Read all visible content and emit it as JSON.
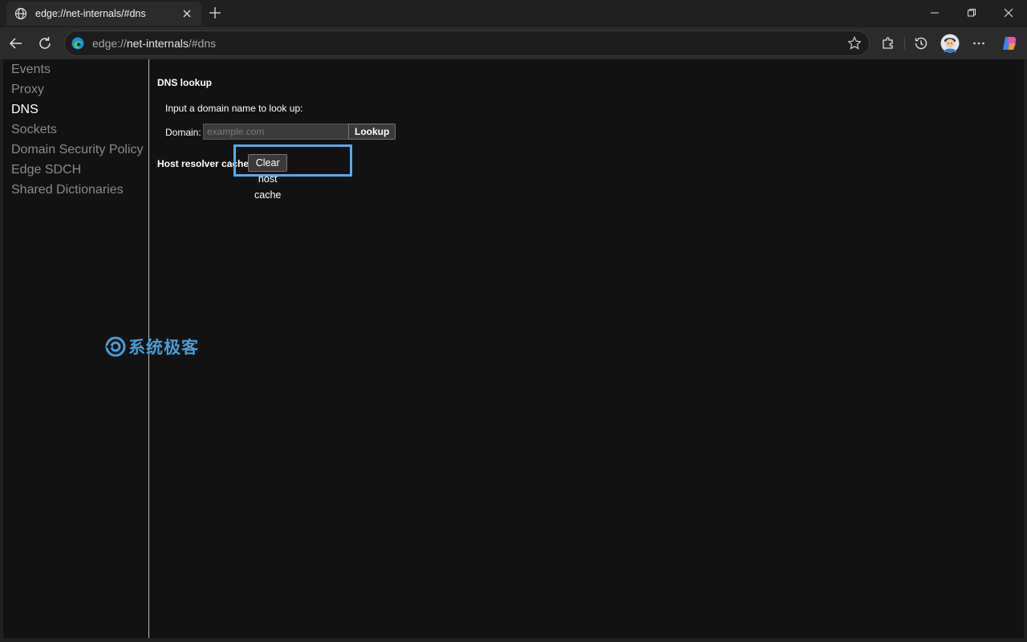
{
  "browser": {
    "tab": {
      "title": "edge://net-internals/#dns",
      "icon": "globe-icon"
    },
    "address_bar": {
      "scheme": "edge://",
      "host": "net-internals",
      "path": "/#dns",
      "icon": "edge-logo-icon"
    }
  },
  "sidebar": {
    "items": [
      {
        "label": "Events",
        "active": false
      },
      {
        "label": "Proxy",
        "active": false
      },
      {
        "label": "DNS",
        "active": true
      },
      {
        "label": "Sockets",
        "active": false
      },
      {
        "label": "Domain Security Policy",
        "active": false
      },
      {
        "label": "Edge SDCH",
        "active": false
      },
      {
        "label": "Shared Dictionaries",
        "active": false
      }
    ]
  },
  "dns_lookup": {
    "title": "DNS lookup",
    "prompt": "Input a domain name to look up:",
    "domain_label": "Domain:",
    "domain_placeholder": "example.com",
    "domain_value": "",
    "lookup_button": "Lookup"
  },
  "host_resolver": {
    "label": "Host resolver cache",
    "clear_button": "Clear host cache"
  },
  "watermark": {
    "text": "系统极客"
  },
  "colors": {
    "page_bg": "#121212",
    "chrome_bg": "#202020",
    "toolbar_bg": "#2b2b2b",
    "highlight": "#5aa9e6",
    "watermark": "#4a9bd4"
  }
}
